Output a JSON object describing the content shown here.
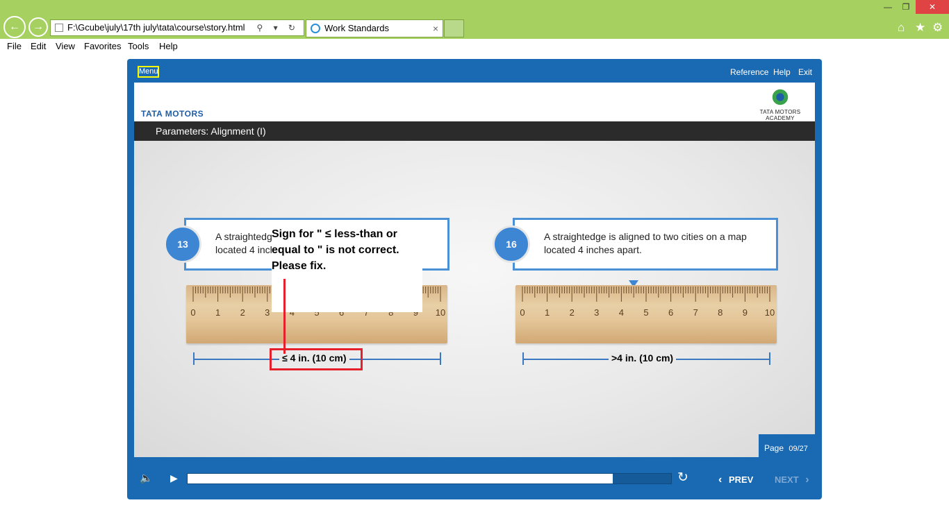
{
  "browser": {
    "address": "F:\\Gcube\\july\\17th july\\tata\\course\\story.html",
    "tab_title": "Work Standards",
    "tab_close": "×",
    "back_glyph": "←",
    "forward_glyph": "→",
    "addr_tools": "⚲ ▾ ↻",
    "window_controls": {
      "minimize": "—",
      "restore": "❐",
      "close": "✕"
    },
    "right_tools": {
      "home": "⌂",
      "favorites": "★",
      "settings": "⚙"
    },
    "menu": [
      "File",
      "Edit",
      "View",
      "Favorites",
      "Tools",
      "Help"
    ]
  },
  "player": {
    "menu_label": "Menu",
    "top_links": [
      "Reference",
      "Help",
      "Exit"
    ],
    "brand_left": "TATA MOTORS",
    "brand_right": "TATA MOTORS ACADEMY",
    "slide_title": "Parameters: Alignment (I)",
    "cards": [
      {
        "number": "13",
        "text": "A straightedge is aligned to two cities on a map located 4 inches apart.",
        "measure_label": "≤ 4 in. (10 cm)"
      },
      {
        "number": "16",
        "text": "A straightedge is aligned to two cities on a map located 4 inches apart.",
        "measure_label": ">4 in. (10 cm)"
      }
    ],
    "ruler_labels": [
      "0",
      "1",
      "2",
      "3",
      "4",
      "5",
      "6",
      "7",
      "8",
      "9",
      "10"
    ],
    "annotation": "Sign for \" ≤ less-than or equal to \" is not correct. Please fix.",
    "page_label": "Page",
    "page_value": "09/27",
    "progress": 0.88,
    "controls": {
      "volume_glyph": "🔈",
      "play_glyph": "▶",
      "replay_glyph": "↻",
      "prev_label": "PREV",
      "next_label": "NEXT",
      "prev_glyph": "‹",
      "next_glyph": "›"
    },
    "colors": {
      "frame": "#1a6ab3",
      "accent": "#3d86d4",
      "annotation": "#e5202a",
      "highlight": "#ffff00"
    }
  }
}
